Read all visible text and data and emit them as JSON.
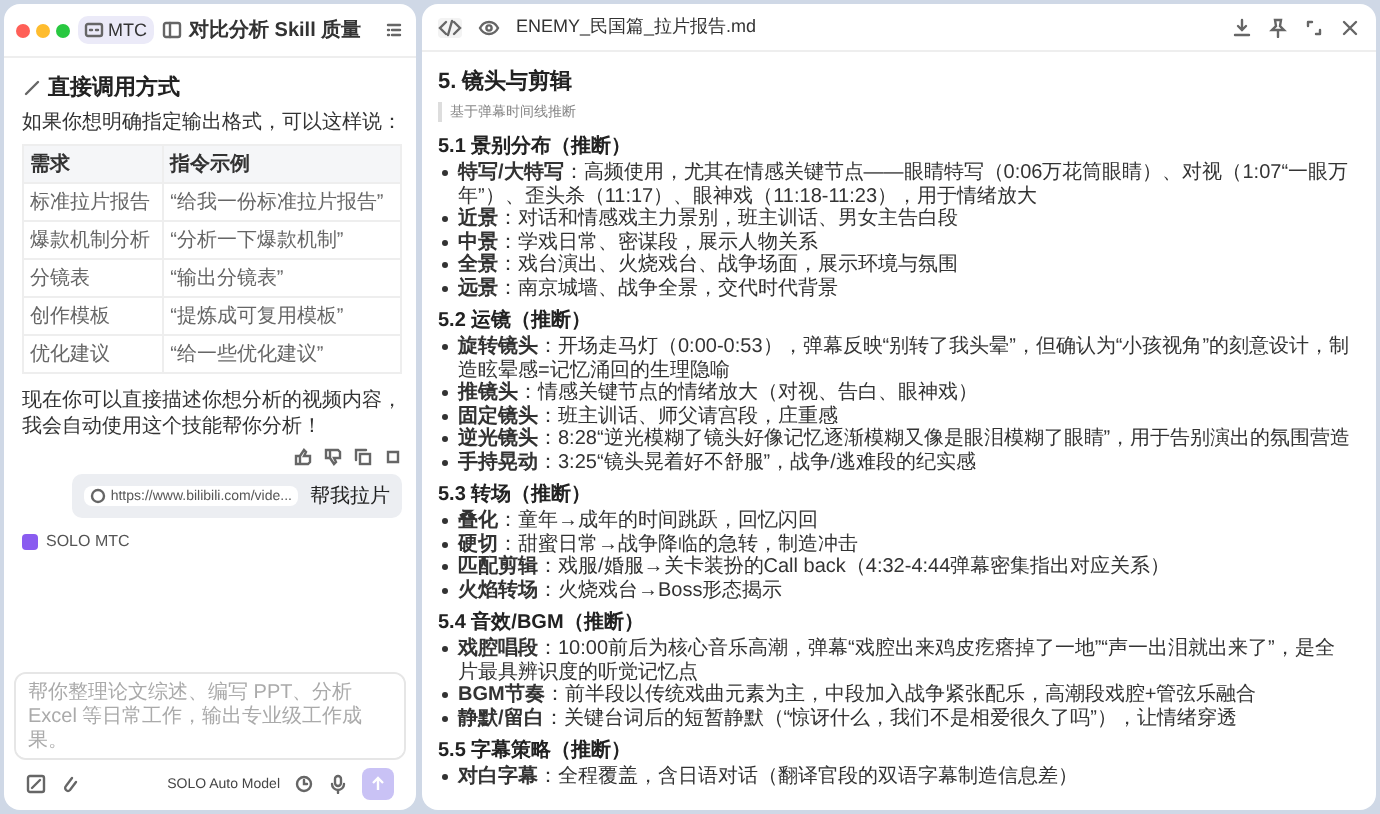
{
  "left_panel": {
    "tab": {
      "label": "MTC",
      "selected": true
    },
    "title": "对比分析 Skill 质量",
    "section_heading": "直接调用方式",
    "intro": "如果你想明确指定输出格式，可以这样说：",
    "table": {
      "columns": [
        "需求",
        "指令示例"
      ],
      "rows": [
        [
          "标准拉片报告",
          "“给我一份标准拉片报告”"
        ],
        [
          "爆款机制分析",
          "“分析一下爆款机制”"
        ],
        [
          "分镜表",
          "“输出分镜表”"
        ],
        [
          "创作模板",
          "“提炼成可复用模板”"
        ],
        [
          "优化建议",
          "“给一些优化建议”"
        ]
      ]
    },
    "closing": "现在你可以直接描述你想分析的视频内容，我会自动使用这个技能帮你分析！",
    "user_message": {
      "link": "https://www.bilibili.com/vide...",
      "text": "帮我拉片"
    },
    "agent_label": "SOLO MTC",
    "composer": {
      "placeholder": "帮你整理论文综述、编写 PPT、分析 Excel 等日常工作，输出专业级工作成果。",
      "model": "SOLO Auto Model"
    }
  },
  "document": {
    "filename": "ENEMY_民国篇_拉片报告.md",
    "heading": "5. 镜头与剪辑",
    "note": "基于弹幕时间线推断",
    "sections": [
      {
        "title": "5.1 景别分布（推断）",
        "items": [
          "**特写/大特写**：高频使用，尤其在情感关键节点——眼睛特写（0:06万花筒眼睛）、对视（1:07“一眼万年”）、歪头杀（11:17）、眼神戏（11:18-11:23），用于情绪放大",
          "**近景**：对话和情感戏主力景别，班主训话、男女主告白段",
          "**中景**：学戏日常、密谋段，展示人物关系",
          "**全景**：戏台演出、火烧戏台、战争场面，展示环境与氛围",
          "**远景**：南京城墙、战争全景，交代时代背景"
        ]
      },
      {
        "title": "5.2 运镜（推断）",
        "items": [
          "**旋转镜头**：开场走马灯（0:00-0:53），弹幕反映“别转了我头晕”，但确认为“小孩视角”的刻意设计，制造眩晕感=记忆涌回的生理隐喻",
          "**推镜头**：情感关键节点的情绪放大（对视、告白、眼神戏）",
          "**固定镜头**：班主训话、师父请宫段，庄重感",
          "**逆光镜头**：8:28“逆光模糊了镜头好像记忆逐渐模糊又像是眼泪模糊了眼睛”，用于告别演出的氛围营造",
          "**手持晃动**：3:25“镜头晃着好不舒服”，战争/逃难段的纪实感"
        ]
      },
      {
        "title": "5.3 转场（推断）",
        "items": [
          "**叠化**：童年→成年的时间跳跃，回忆闪回",
          "**硬切**：甜蜜日常→战争降临的急转，制造冲击",
          "**匹配剪辑**：戏服/婚服→关卡装扮的Call back（4:32-4:44弹幕密集指出对应关系）",
          "**火焰转场**：火烧戏台→Boss形态揭示"
        ]
      },
      {
        "title": "5.4 音效/BGM（推断）",
        "items": [
          "**戏腔唱段**：10:00前后为核心音乐高潮，弹幕“戏腔出来鸡皮疙瘩掉了一地”“声一出泪就出来了”，是全片最具辨识度的听觉记忆点",
          "**BGM节奏**：前半段以传统戏曲元素为主，中段加入战争紧张配乐，高潮段戏腔+管弦乐融合",
          "**静默/留白**：关键台词后的短暂静默（“惊讶什么，我们不是相爱很久了吗”），让情绪穿透"
        ]
      },
      {
        "title": "5.5 字幕策略（推断）",
        "items": [
          "**对白字幕**：全程覆盖，含日语对话（翻译官段的双语字幕制造信息差）"
        ]
      }
    ]
  }
}
